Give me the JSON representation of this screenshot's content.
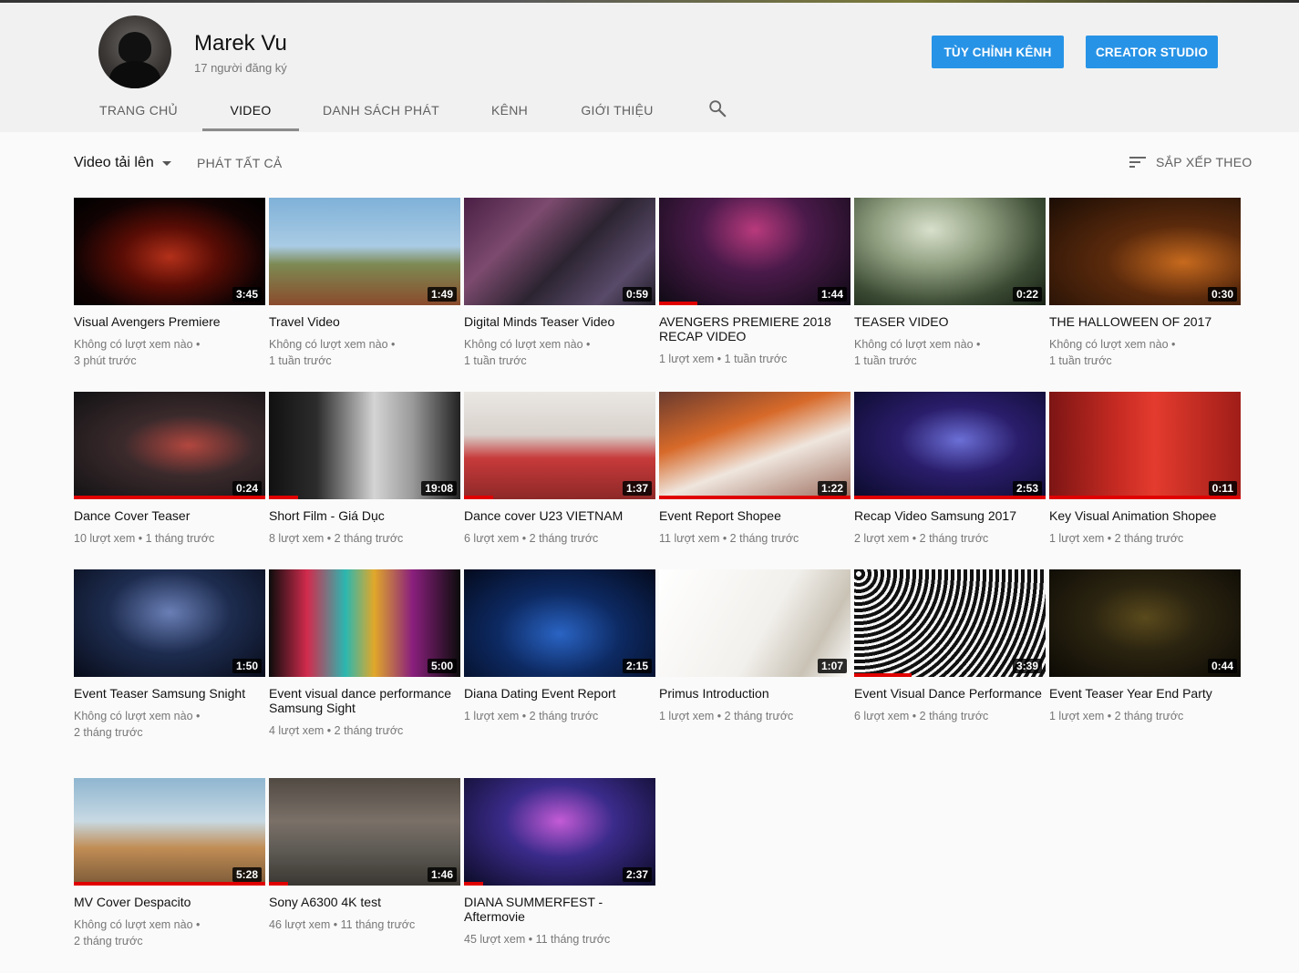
{
  "channel": {
    "name": "Marek Vu",
    "subscribers": "17 người đăng ký",
    "customize_label": "TÙY CHỈNH KÊNH",
    "studio_label": "CREATOR STUDIO"
  },
  "tabs": [
    {
      "label": "TRANG CHỦ"
    },
    {
      "label": "VIDEO"
    },
    {
      "label": "DANH SÁCH PHÁT"
    },
    {
      "label": "KÊNH"
    },
    {
      "label": "GIỚI THIỆU"
    }
  ],
  "toolbar": {
    "uploads_label": "Video tải lên",
    "play_all_label": "PHÁT TẤT CẢ",
    "sort_label": "SẮP XẾP THEO"
  },
  "videos": [
    {
      "title": "Visual Avengers Premiere",
      "duration": "3:45",
      "meta1": "Không có lượt xem nào •",
      "meta2": "3 phút trước",
      "progress": 0
    },
    {
      "title": "Travel Video",
      "duration": "1:49",
      "meta1": "Không có lượt xem nào •",
      "meta2": "1 tuần trước",
      "progress": 0
    },
    {
      "title": "Digital Minds Teaser Video",
      "duration": "0:59",
      "meta1": "Không có lượt xem nào •",
      "meta2": "1 tuần trước",
      "progress": 0
    },
    {
      "title": "AVENGERS PREMIERE 2018 RECAP VIDEO",
      "duration": "1:44",
      "meta1": "1 lượt xem • 1 tuần trước",
      "meta2": "",
      "progress": 0.2
    },
    {
      "title": "TEASER VIDEO",
      "duration": "0:22",
      "meta1": "Không có lượt xem nào •",
      "meta2": "1 tuần trước",
      "progress": 0
    },
    {
      "title": "THE HALLOWEEN OF 2017",
      "duration": "0:30",
      "meta1": "Không có lượt xem nào •",
      "meta2": "1 tuần trước",
      "progress": 0
    },
    {
      "title": "Dance Cover Teaser",
      "duration": "0:24",
      "meta1": "10 lượt xem • 1 tháng trước",
      "meta2": "",
      "progress": 1
    },
    {
      "title": "Short Film - Giá Dục",
      "duration": "19:08",
      "meta1": "8 lượt xem • 2 tháng trước",
      "meta2": "",
      "progress": 0.15
    },
    {
      "title": "Dance cover U23 VIETNAM",
      "duration": "1:37",
      "meta1": "6 lượt xem • 2 tháng trước",
      "meta2": "",
      "progress": 0.15
    },
    {
      "title": "Event Report Shopee",
      "duration": "1:22",
      "meta1": "11 lượt xem • 2 tháng trước",
      "meta2": "",
      "progress": 1
    },
    {
      "title": "Recap Video Samsung 2017",
      "duration": "2:53",
      "meta1": "2 lượt xem • 2 tháng trước",
      "meta2": "",
      "progress": 1
    },
    {
      "title": "Key Visual Animation Shopee",
      "duration": "0:11",
      "meta1": "1 lượt xem • 2 tháng trước",
      "meta2": "",
      "progress": 1
    },
    {
      "title": "Event Teaser Samsung Snight",
      "duration": "1:50",
      "meta1": "Không có lượt xem nào •",
      "meta2": "2 tháng trước",
      "progress": 0
    },
    {
      "title": "Event visual dance performance Samsung Sight",
      "duration": "5:00",
      "meta1": "4 lượt xem • 2 tháng trước",
      "meta2": "",
      "progress": 0
    },
    {
      "title": "Diana Dating Event Report",
      "duration": "2:15",
      "meta1": "1 lượt xem • 2 tháng trước",
      "meta2": "",
      "progress": 0
    },
    {
      "title": "Primus Introduction",
      "duration": "1:07",
      "meta1": "1 lượt xem • 2 tháng trước",
      "meta2": "",
      "progress": 0
    },
    {
      "title": "Event Visual Dance Performance",
      "duration": "3:39",
      "meta1": "6 lượt xem • 2 tháng trước",
      "meta2": "",
      "progress": 0.3
    },
    {
      "title": "Event Teaser Year End Party",
      "duration": "0:44",
      "meta1": "1 lượt xem • 2 tháng trước",
      "meta2": "",
      "progress": 0
    },
    {
      "title": "MV Cover Despacito",
      "duration": "5:28",
      "meta1": "Không có lượt xem nào •",
      "meta2": "2 tháng trước",
      "progress": 1
    },
    {
      "title": "Sony A6300 4K test",
      "duration": "1:46",
      "meta1": "46 lượt xem • 11 tháng trước",
      "meta2": "",
      "progress": 0.1
    },
    {
      "title": "DIANA SUMMERFEST - Aftermovie",
      "duration": "2:37",
      "meta1": "45 lượt xem • 11 tháng trước",
      "meta2": "",
      "progress": 0.1
    }
  ],
  "colors": {
    "accent": "#2793e6",
    "progress": "#e00000"
  },
  "icons": {
    "search": "search-icon",
    "sort": "sort-icon",
    "dropdown": "chevron-down-icon"
  }
}
